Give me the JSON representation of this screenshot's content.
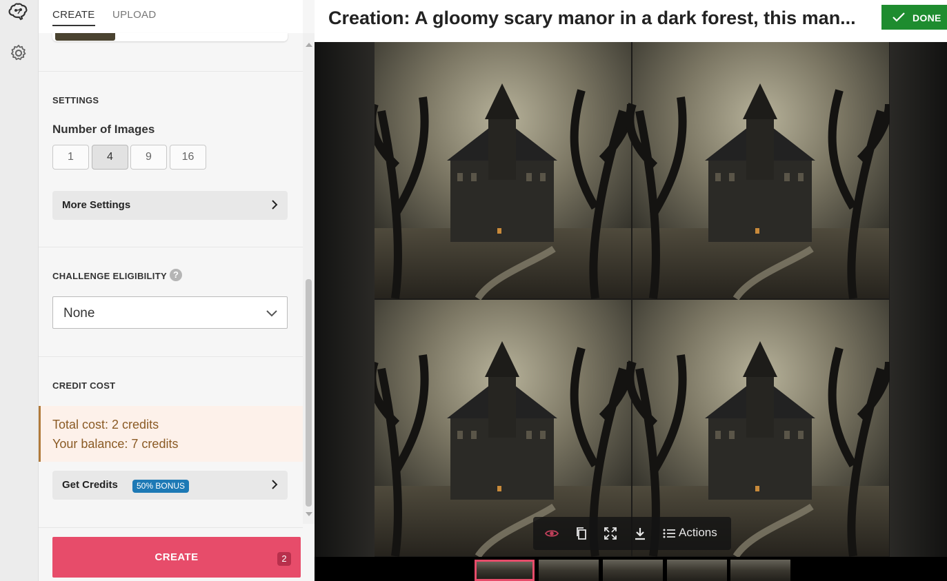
{
  "tabs": {
    "create": "CREATE",
    "upload": "UPLOAD"
  },
  "settings": {
    "heading": "SETTINGS",
    "number_of_images_label": "Number of Images",
    "options": [
      "1",
      "4",
      "9",
      "16"
    ],
    "selected": "4",
    "more_settings": "More Settings"
  },
  "challenge": {
    "heading": "CHALLENGE ELIGIBILITY",
    "help": "?",
    "selected": "None"
  },
  "credit": {
    "heading": "CREDIT COST",
    "total": "Total cost: 2 credits",
    "balance": "Your balance: 7 credits",
    "get_credits": "Get Credits",
    "bonus": "50% BONUS"
  },
  "create_button": {
    "label": "CREATE",
    "badge": "2"
  },
  "header": {
    "title": "Creation: A gloomy scary manor in a dark forest, this man...",
    "done": "DONE"
  },
  "toolbar": {
    "actions": "Actions"
  },
  "colors": {
    "accent": "#e74c6a",
    "done": "#1e8c2f",
    "bonus": "#1d79b5",
    "cost_text": "#8a5a24"
  },
  "icons": [
    "brain-logo-icon",
    "gear-icon",
    "chevron-right-icon",
    "chevron-down-icon",
    "help-icon",
    "check-icon",
    "eye-icon",
    "copy-icon",
    "fullscreen-icon",
    "download-icon",
    "list-icon"
  ]
}
